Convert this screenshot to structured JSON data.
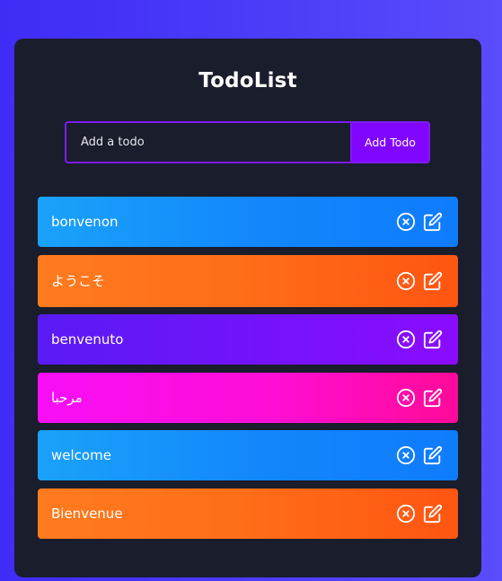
{
  "app": {
    "title": "TodoList"
  },
  "form": {
    "placeholder": "Add a todo",
    "value": "",
    "button_label": "Add Todo"
  },
  "todos": [
    {
      "text": "bonvenon",
      "color": "blue"
    },
    {
      "text": "ようこそ",
      "color": "orange"
    },
    {
      "text": "benvenuto",
      "color": "purple"
    },
    {
      "text": "مرحبا",
      "color": "pink"
    },
    {
      "text": "welcome",
      "color": "blue"
    },
    {
      "text": "Bienvenue",
      "color": "orange"
    }
  ],
  "colors": {
    "background": "#4636f7",
    "panel": "#1a1d2b",
    "accent": "#8106ff",
    "blue": "#1286fb",
    "orange": "#ff6d18",
    "purple": "#7412fb",
    "pink": "#ff0ed6"
  },
  "icons": {
    "delete": "close-circle-icon",
    "edit": "edit-icon"
  }
}
